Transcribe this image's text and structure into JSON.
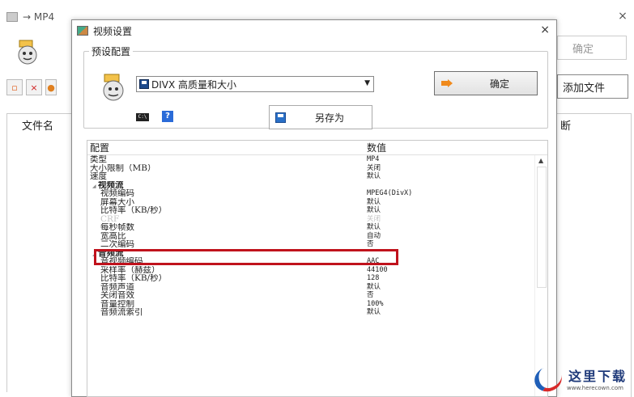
{
  "main": {
    "title": "→ MP4",
    "close_glyph": "×",
    "ok_button": "确定",
    "add_file_button": "添加文件",
    "file_name_header": "文件名",
    "right_header": "断",
    "toolbar_icons": [
      "add-doc-icon",
      "delete-icon",
      "orange-icon"
    ]
  },
  "dialog": {
    "title": "视频设置",
    "close_glyph": "×",
    "preset": {
      "legend": "预设配置",
      "selected_profile": "DIVX 高质量和大小",
      "ok_button": "确定",
      "save_as_button": "另存为",
      "cmd_icon_text": "C:\\",
      "help_icon_text": "?"
    },
    "grid": {
      "header_name": "配置",
      "header_value": "数值",
      "rows": [
        {
          "name": "类型",
          "value": "MP4",
          "kind": "prop",
          "level": 0
        },
        {
          "name": "大小限制（MB）",
          "value": "关闭",
          "kind": "prop",
          "level": 0
        },
        {
          "name": "速度",
          "value": "默认",
          "kind": "prop",
          "level": 0
        },
        {
          "name": "视频流",
          "value": "",
          "kind": "cat",
          "level": 0
        },
        {
          "name": "视频编码",
          "value": "MPEG4(DivX)",
          "kind": "prop",
          "level": 1
        },
        {
          "name": "屏幕大小",
          "value": "默认",
          "kind": "prop",
          "level": 1
        },
        {
          "name": "比特率（KB/秒）",
          "value": "默认",
          "kind": "prop",
          "level": 1
        },
        {
          "name": "CRF",
          "value": "关闭",
          "kind": "disabled",
          "level": 1
        },
        {
          "name": "每秒帧数",
          "value": "默认",
          "kind": "prop",
          "level": 1
        },
        {
          "name": "宽高比",
          "value": "自动",
          "kind": "prop",
          "level": 1
        },
        {
          "name": "二次编码",
          "value": "否",
          "kind": "prop",
          "level": 1
        },
        {
          "name": "音频流",
          "value": "",
          "kind": "cat",
          "level": 0
        },
        {
          "name": "音视频编码",
          "value": "AAC",
          "kind": "prop",
          "level": 1
        },
        {
          "name": "采样率（赫兹）",
          "value": "44100",
          "kind": "prop",
          "level": 1
        },
        {
          "name": "比特率（KB/秒）",
          "value": "128",
          "kind": "prop",
          "level": 1
        },
        {
          "name": "音频声道",
          "value": "默认",
          "kind": "prop",
          "level": 1
        },
        {
          "name": "关闭音效",
          "value": "否",
          "kind": "prop",
          "level": 1
        },
        {
          "name": "音量控制",
          "value": "100%",
          "kind": "prop",
          "level": 1
        },
        {
          "name": "音频流索引",
          "value": "默认",
          "kind": "prop",
          "level": 1
        }
      ]
    }
  },
  "watermark": {
    "text": "这里下载",
    "url": "www.herecown.com"
  }
}
